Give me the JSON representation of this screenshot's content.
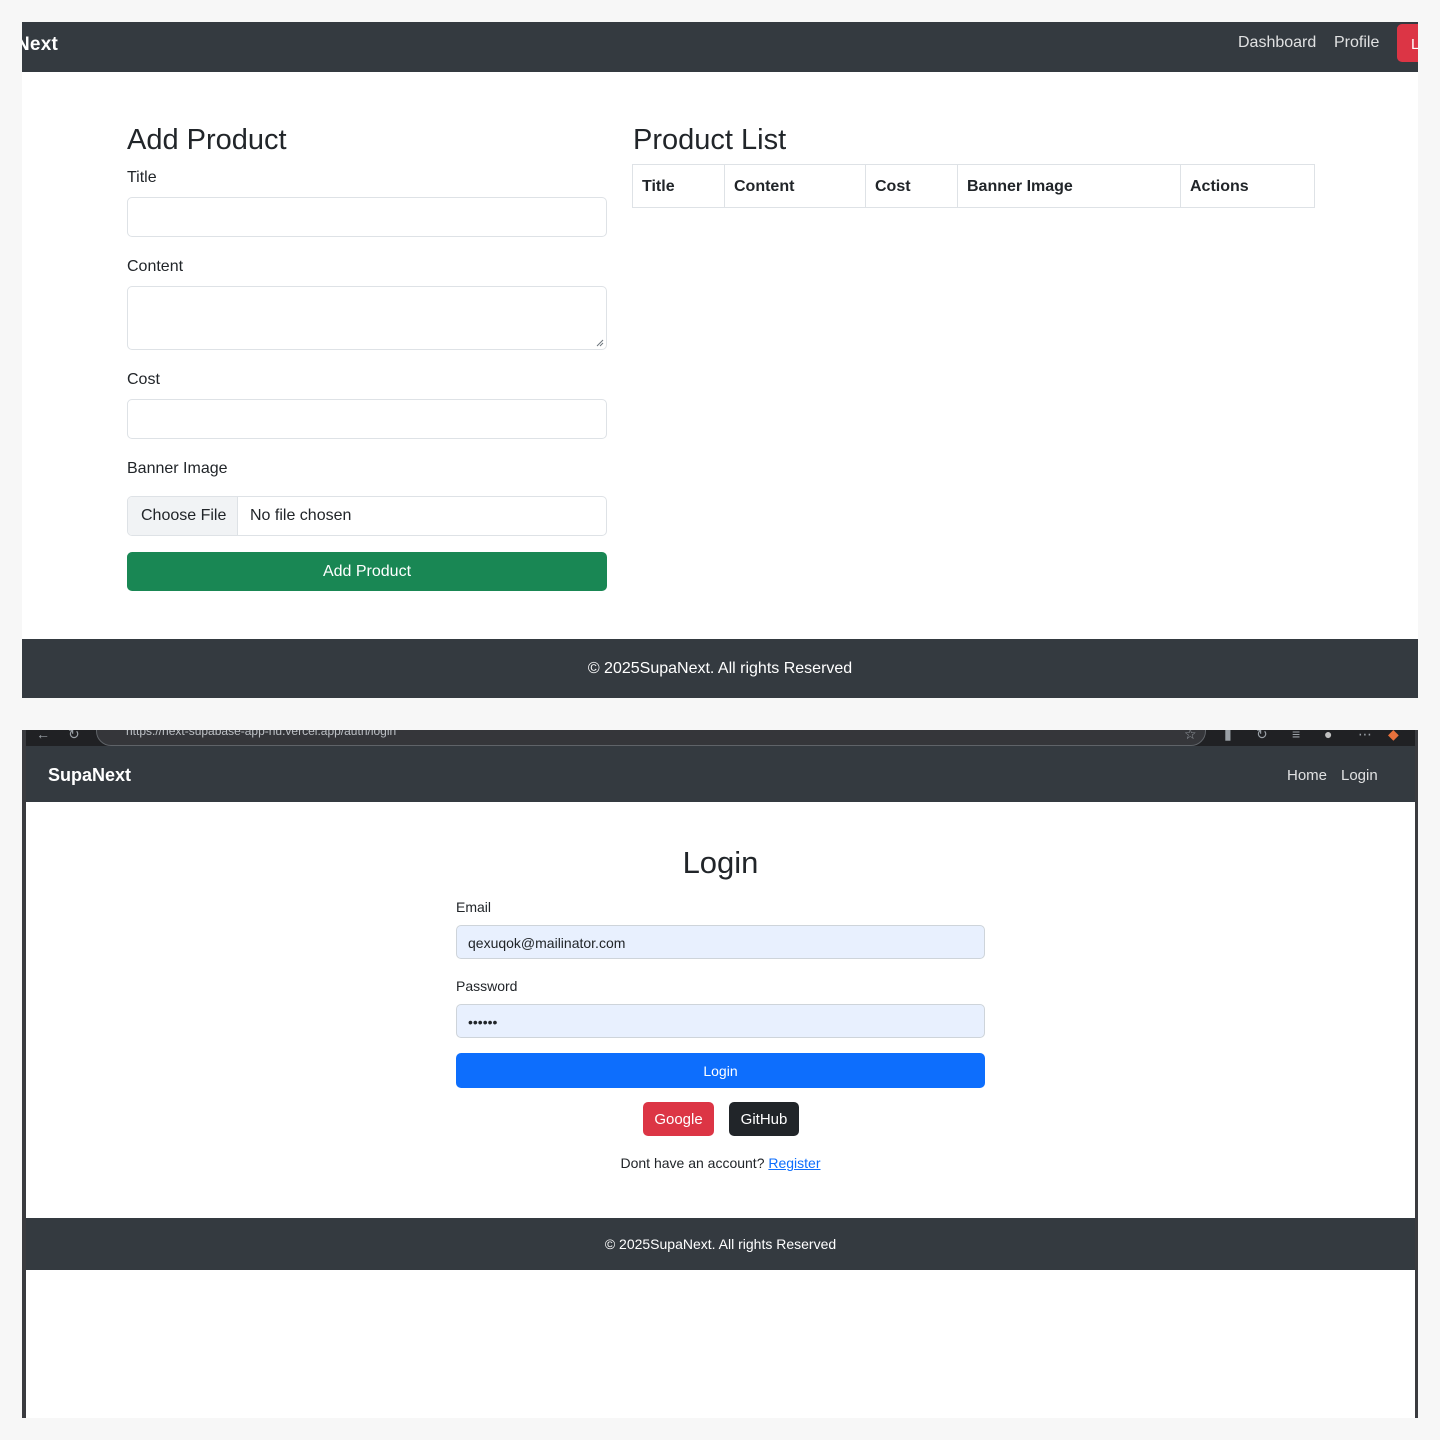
{
  "dashboard": {
    "nav": {
      "brand": "Next",
      "links": [
        "Dashboard",
        "Profile"
      ],
      "logout_label": "L"
    },
    "form": {
      "heading": "Add Product",
      "title_label": "Title",
      "content_label": "Content",
      "cost_label": "Cost",
      "banner_label": "Banner Image",
      "file_button": "Choose File",
      "file_status": "No file chosen",
      "submit_label": "Add Product"
    },
    "list": {
      "heading": "Product List",
      "columns": [
        "Title",
        "Content",
        "Cost",
        "Banner Image",
        "Actions"
      ]
    },
    "footer": "© 2025SupaNext. All rights Reserved"
  },
  "login": {
    "browser": {
      "url": "https://next-supabase-app-nu.vercel.app/auth/login"
    },
    "nav": {
      "brand": "SupaNext",
      "links": [
        "Home",
        "Login"
      ]
    },
    "heading": "Login",
    "email_label": "Email",
    "email_value": "qexuqok@mailinator.com",
    "password_label": "Password",
    "password_value": "••••••",
    "login_button": "Login",
    "google_button": "Google",
    "github_button": "GitHub",
    "account_prompt": "Dont have an account?",
    "register_link": "Register",
    "footer": "© 2025SupaNext. All rights Reserved"
  },
  "colors": {
    "navbar": "#343a40",
    "success": "#198754",
    "primary": "#0d6efd",
    "danger": "#dc3545",
    "dark": "#212529",
    "autofill": "#e8f0fe"
  }
}
